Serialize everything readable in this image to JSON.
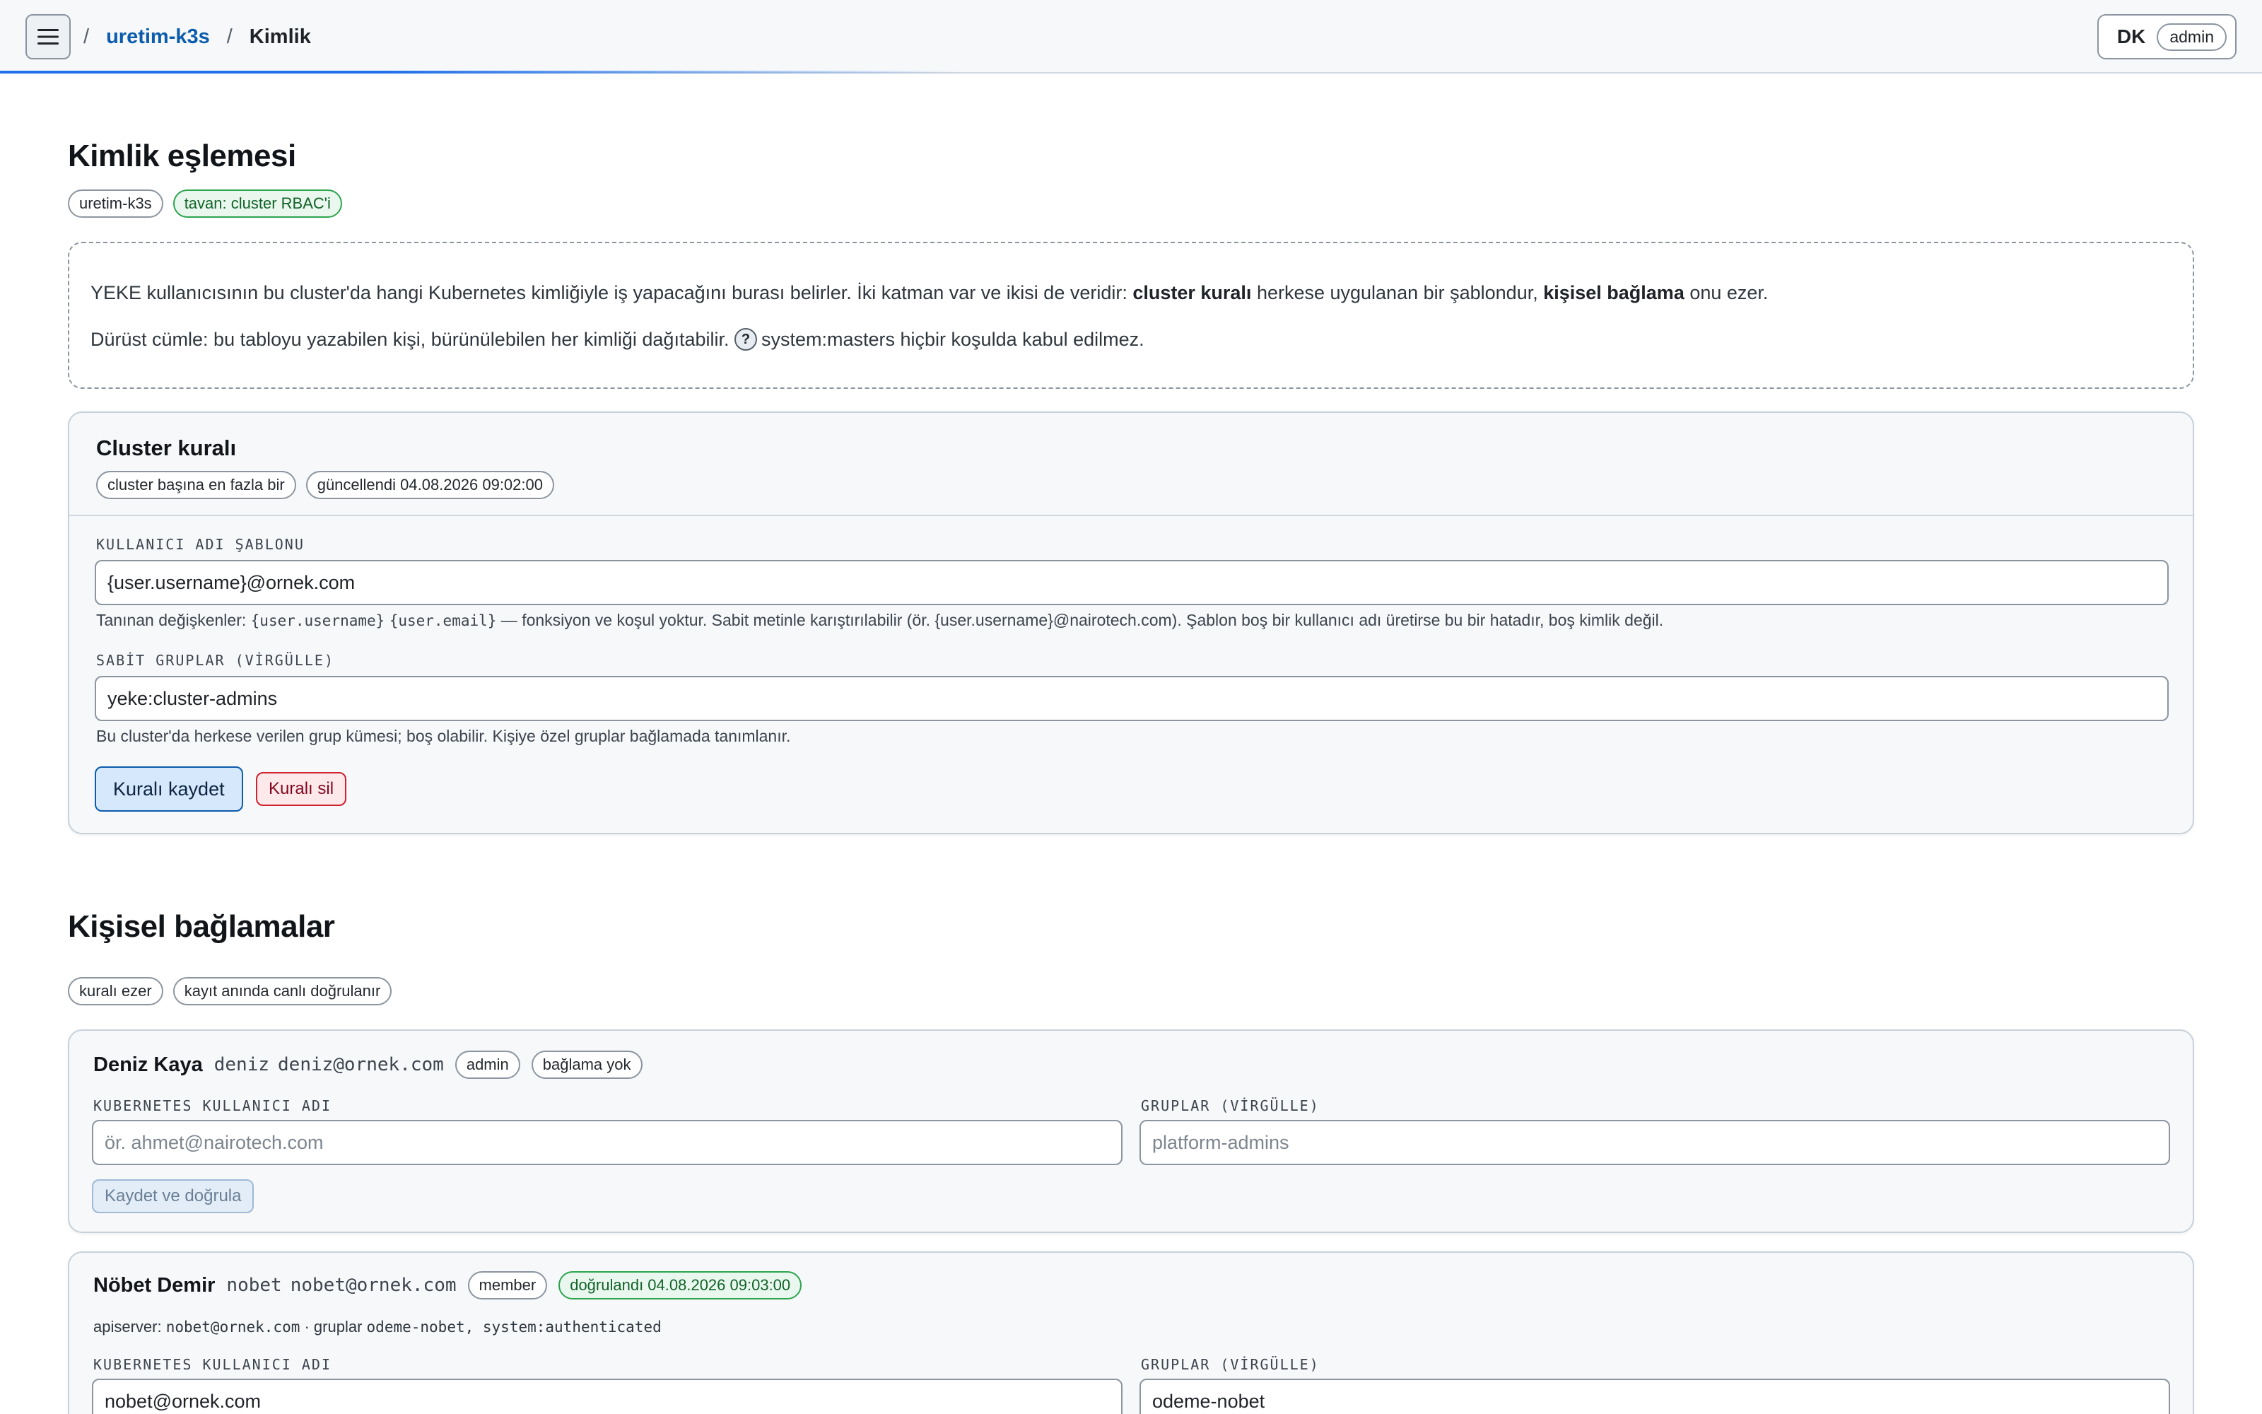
{
  "header": {
    "breadcrumb_sep": "/",
    "cluster_link": "uretim-k3s",
    "current": "Kimlik",
    "user_initials": "DK",
    "user_role": "admin"
  },
  "page": {
    "title": "Kimlik eşlemesi",
    "badges": [
      "uretim-k3s",
      "tavan: cluster RBAC'i"
    ]
  },
  "intro": {
    "line1_a": "YEKE kullanıcısının bu cluster'da hangi Kubernetes kimliğiyle iş yapacağını burası belirler. İki katman var ve ikisi de veridir: ",
    "line1_b": "cluster kuralı",
    "line1_c": " herkese uygulanan bir şablondur, ",
    "line1_d": "kişisel bağlama",
    "line1_e": " onu ezer.",
    "line2_a": "Dürüst cümle: bu tabloyu yazabilen kişi, bürünülebilen her kimliği dağıtabilir. ",
    "line2_help": "?",
    "line2_b": "system:masters hiçbir koşulda kabul edilmez."
  },
  "cluster_rule": {
    "title": "Cluster kuralı",
    "badges": [
      "cluster başına en fazla bir",
      "güncellendi 04.08.2026 09:02:00"
    ],
    "username_label": "KULLANICI ADI ŞABLONU",
    "username_value": "{user.username}@ornek.com",
    "username_hint_a": "Tanınan değişkenler: ",
    "username_hint_var1": "{user.username}",
    "username_hint_var2": "{user.email}",
    "username_hint_b": " — fonksiyon ve koşul yoktur. Sabit metinle karıştırılabilir (ör. {user.username}@nairotech.com). Şablon boş bir kullanıcı adı üretirse bu bir hatadır, boş kimlik değil.",
    "groups_label": "SABİT GRUPLAR (VİRGÜLLE)",
    "groups_value": "yeke:cluster-admins",
    "groups_hint": "Bu cluster'da herkese verilen grup kümesi; boş olabilir. Kişiye özel gruplar bağlamada tanımlanır.",
    "save_label": "Kuralı kaydet",
    "delete_label": "Kuralı sil"
  },
  "bindings": {
    "title": "Kişisel bağlamalar",
    "badges": [
      "kuralı ezer",
      "kayıt anında canlı doğrulanır"
    ],
    "username_label": "KUBERNETES KULLANICI ADI",
    "groups_label": "GRUPLAR (VİRGÜLLE)",
    "items": [
      {
        "name": "Deniz Kaya",
        "login": "deniz",
        "email": "deniz@ornek.com",
        "role": "admin",
        "status": "bağlama yok",
        "username_value": "",
        "username_placeholder": "ör. ahmet@nairotech.com",
        "groups_value": "",
        "groups_placeholder": "platform-admins",
        "save_label": "Kaydet ve doğrula"
      },
      {
        "name": "Nöbet Demir",
        "login": "nobet",
        "email": "nobet@ornek.com",
        "role": "member",
        "status": "doğrulandı 04.08.2026 09:03:00",
        "apiserver_label": "apiserver: ",
        "apiserver_user": "nobet@ornek.com",
        "apiserver_mid": " · gruplar ",
        "apiserver_groups": "odeme-nobet, system:authenticated",
        "username_value": "nobet@ornek.com",
        "groups_value": "odeme-nobet"
      }
    ]
  },
  "colors": {
    "accent": "#0b5cad",
    "verified_green": "#2da44e",
    "danger": "#cf222e"
  }
}
